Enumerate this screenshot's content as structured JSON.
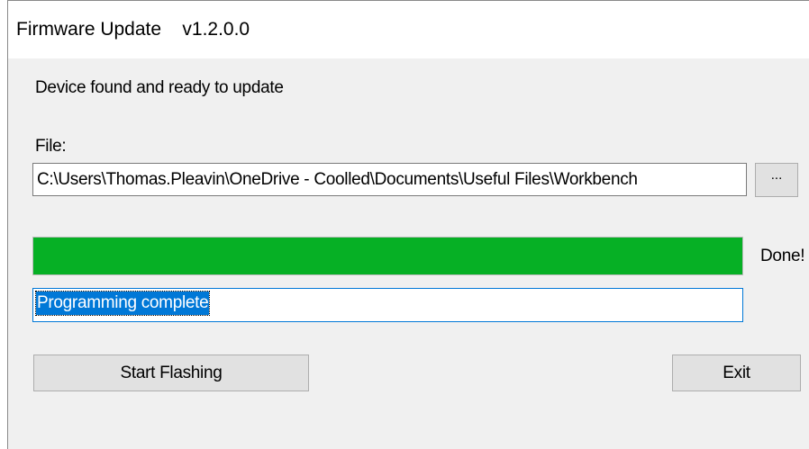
{
  "window": {
    "title": "Firmware Update    v1.2.0.0"
  },
  "status": {
    "message": "Device found and ready to update"
  },
  "file": {
    "label": "File:",
    "path": "C:\\Users\\Thomas.Pleavin\\OneDrive - Coolled\\Documents\\Useful Files\\Workbench",
    "browse_label": "..."
  },
  "progress": {
    "value_percent": 100,
    "status_label": "Done!",
    "fill_color": "#06b025"
  },
  "output": {
    "text": "Programming complete",
    "selection_color": "#0078d7"
  },
  "actions": {
    "start_label": "Start Flashing",
    "exit_label": "Exit"
  }
}
